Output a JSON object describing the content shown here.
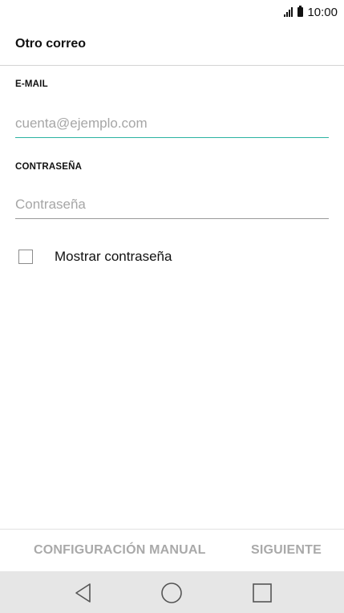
{
  "status_bar": {
    "time": "10:00",
    "signal_icon": "signal-bars-icon",
    "battery_icon": "battery-icon"
  },
  "header": {
    "title": "Otro correo"
  },
  "form": {
    "email": {
      "label": "E-MAIL",
      "placeholder": "cuenta@ejemplo.com",
      "value": ""
    },
    "password": {
      "label": "CONTRASEÑA",
      "placeholder": "Contraseña",
      "value": ""
    },
    "show_password": {
      "label": "Mostrar contraseña",
      "checked": false
    }
  },
  "footer": {
    "manual_label": "CONFIGURACIÓN MANUAL",
    "next_label": "SIGUIENTE"
  },
  "navigation": {
    "back_icon": "back-triangle-icon",
    "home_icon": "home-circle-icon",
    "recent_icon": "recent-apps-square-icon"
  },
  "colors": {
    "accent": "#2bb3a1",
    "disabled_text": "#a9a9a9",
    "nav_bar_bg": "#e6e6e6"
  }
}
